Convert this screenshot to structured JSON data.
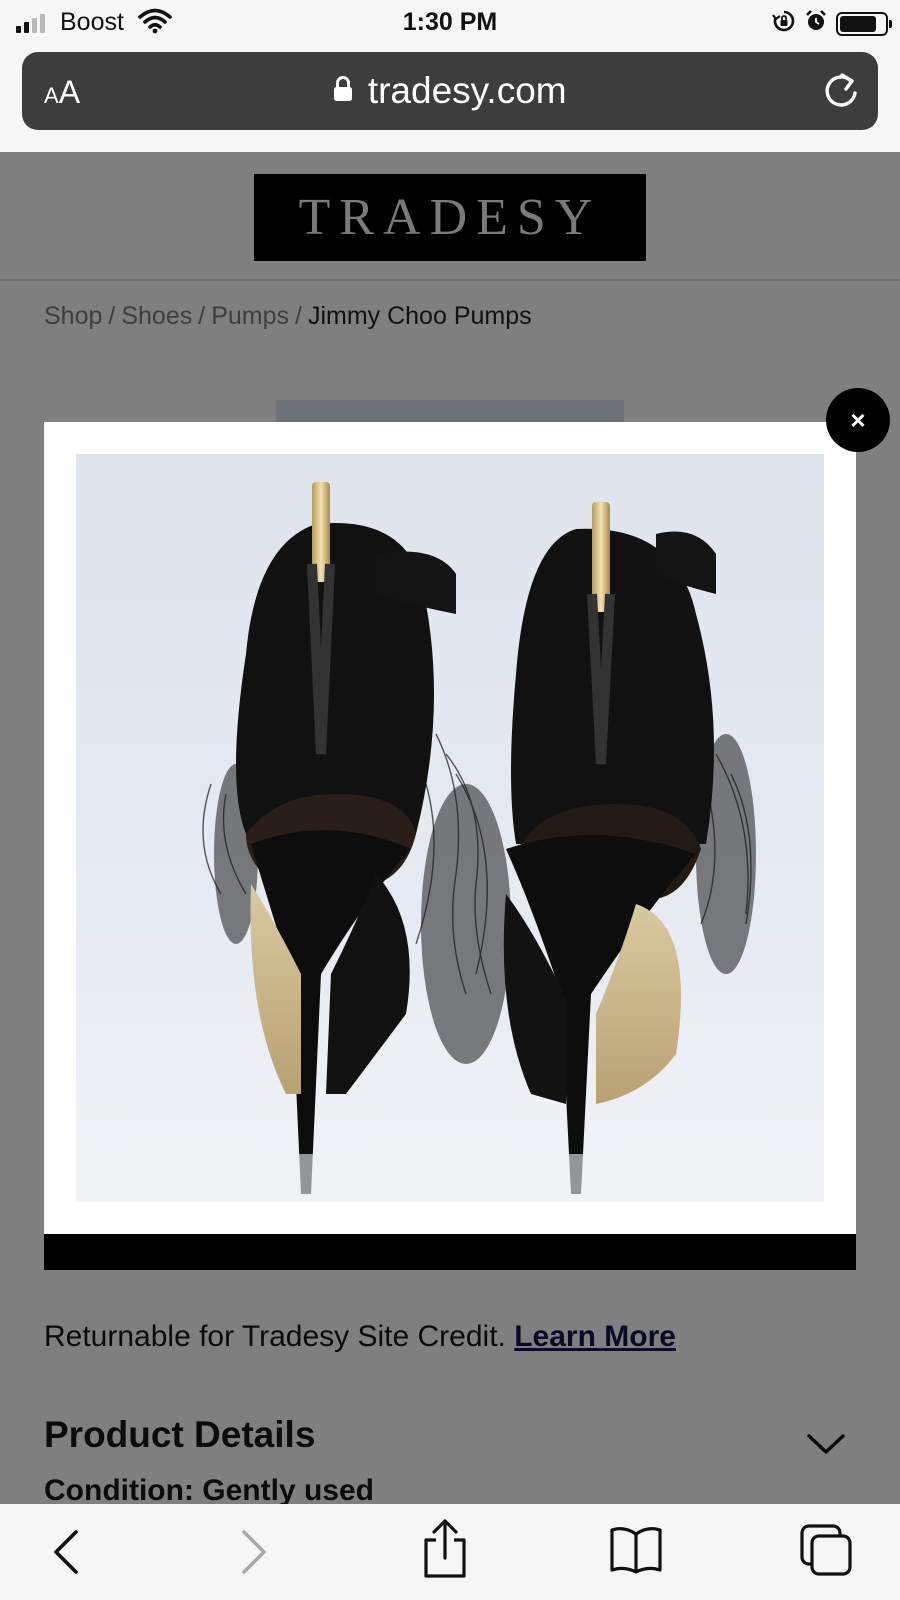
{
  "status_bar": {
    "carrier": "Boost",
    "time": "1:30 PM"
  },
  "browser": {
    "text_size_small": "A",
    "text_size_large": "A",
    "domain": "tradesy.com"
  },
  "site": {
    "logo": "TRADESY",
    "breadcrumb": {
      "items": [
        "Shop",
        "Shoes",
        "Pumps"
      ],
      "separator": "/",
      "current": "Jimmy Choo Pumps"
    },
    "returnable_text": "Returnable for Tradesy Site Credit.",
    "learn_more": "Learn More",
    "product_details_title": "Product Details",
    "condition": "Condition: Gently used"
  },
  "modal": {
    "close_label": "×",
    "image_subject": "black satin Jimmy Choo stiletto sandals with feather trim, rear view"
  },
  "toolbar": {
    "icons": [
      "back-icon",
      "forward-icon",
      "share-icon",
      "bookmarks-icon",
      "tabs-icon"
    ]
  },
  "colors": {
    "overlay_gray": "#7f7f7f",
    "url_bar": "#3d3d3d",
    "toolbar_blue_disabled": "#a9a9a9"
  }
}
